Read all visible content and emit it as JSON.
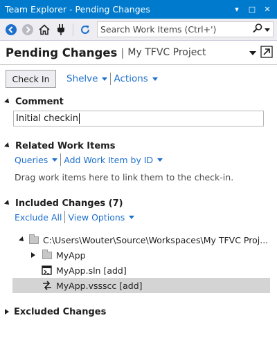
{
  "window": {
    "title": "Team Explorer - Pending Changes",
    "controls": [
      "▾",
      "□",
      "✕"
    ]
  },
  "toolbar": {
    "search_placeholder": "Search Work Items (Ctrl+')"
  },
  "header": {
    "title": "Pending Changes",
    "separator": "|",
    "project": "My TFVC Project"
  },
  "actions": {
    "checkin_label": "Check In",
    "shelve_label": "Shelve",
    "actions_label": "Actions"
  },
  "comment": {
    "heading": "Comment",
    "value": "Initial checkin"
  },
  "related": {
    "heading": "Related Work Items",
    "queries_label": "Queries",
    "add_by_id_label": "Add Work Item by ID",
    "help_text": "Drag work items here to link them to the check-in."
  },
  "included": {
    "heading": "Included Changes (7)",
    "exclude_all_label": "Exclude All",
    "view_options_label": "View Options",
    "tree": {
      "root_path": "C:\\Users\\Wouter\\Source\\Workspaces\\My TFVC Proj...",
      "items": [
        {
          "label": "MyApp"
        },
        {
          "label": "MyApp.sln [add]"
        },
        {
          "label": "MyApp.vssscc [add]"
        }
      ]
    }
  },
  "excluded": {
    "heading": "Excluded Changes"
  }
}
